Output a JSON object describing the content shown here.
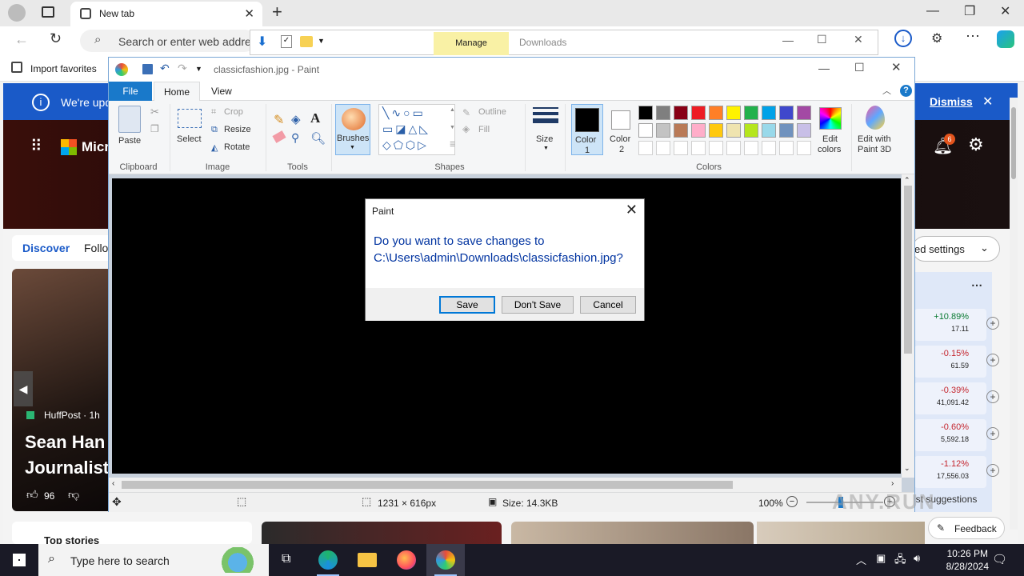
{
  "browser": {
    "tab_title": "New tab",
    "address_placeholder": "Search or enter web address",
    "fav_import": "Import favorites"
  },
  "downloads_overlay": {
    "manage_label": "Manage",
    "title": "Downloads"
  },
  "msn": {
    "banner_text": "We're upd",
    "dismiss": "Dismiss",
    "brand": "Micr",
    "tab_discover": "Discover",
    "tab_following": "Follo",
    "settings_btn": "ed settings",
    "notification_count": "6",
    "feed": {
      "source": "HuffPost · 1h",
      "headline_line1": "Sean Han",
      "headline_line2": "Journalist",
      "likes": "96"
    },
    "stocks": [
      {
        "pct": "+10.89%",
        "val": "17.11",
        "color": "#0a7a32"
      },
      {
        "pct": "-0.15%",
        "val": "61.59",
        "color": "#c4262e"
      },
      {
        "pct": "-0.39%",
        "val": "41,091.42",
        "color": "#c4262e"
      },
      {
        "pct": "-0.60%",
        "val": "5,592.18",
        "color": "#c4262e"
      },
      {
        "pct": "-1.12%",
        "val": "17,556.03",
        "color": "#c4262e"
      }
    ],
    "suggestions": "ist suggestions",
    "top_stories": "Top stories",
    "feedback": "Feedback"
  },
  "paint": {
    "window_title": "classicfashion.jpg - Paint",
    "tabs": {
      "file": "File",
      "home": "Home",
      "view": "View"
    },
    "groups": {
      "clipboard": "Clipboard",
      "image": "Image",
      "tools": "Tools",
      "shapes": "Shapes",
      "colors": "Colors"
    },
    "buttons": {
      "paste": "Paste",
      "select": "Select",
      "crop": "Crop",
      "resize": "Resize",
      "rotate": "Rotate",
      "brushes": "Brushes",
      "outline": "Outline",
      "fill": "Fill",
      "size": "Size",
      "color1_line1": "Color",
      "color1_line2": "1",
      "color2_line1": "Color",
      "color2_line2": "2",
      "edit_colors_line1": "Edit",
      "edit_colors_line2": "colors",
      "paint3d_line1": "Edit with",
      "paint3d_line2": "Paint 3D"
    },
    "palette_row1": [
      "#000000",
      "#7f7f7f",
      "#880015",
      "#ed1c24",
      "#ff7f27",
      "#fff200",
      "#22b14c",
      "#00a2e8",
      "#3f48cc",
      "#a349a4"
    ],
    "palette_row2": [
      "#ffffff",
      "#c3c3c3",
      "#b97a57",
      "#ffaec9",
      "#ffc90e",
      "#efe4b0",
      "#b5e61d",
      "#99d9ea",
      "#7092be",
      "#c8bfe7"
    ],
    "status": {
      "dimensions": "1231 × 616px",
      "size": "Size: 14.3KB",
      "zoom": "100%"
    }
  },
  "dialog": {
    "title": "Paint",
    "message_line1": "Do you want to save changes to",
    "message_line2": "C:\\Users\\admin\\Downloads\\classicfashion.jpg?",
    "save": "Save",
    "dont_save": "Don't Save",
    "cancel": "Cancel"
  },
  "taskbar": {
    "search_placeholder": "Type here to search",
    "time": "10:26 PM",
    "date": "8/28/2024"
  }
}
